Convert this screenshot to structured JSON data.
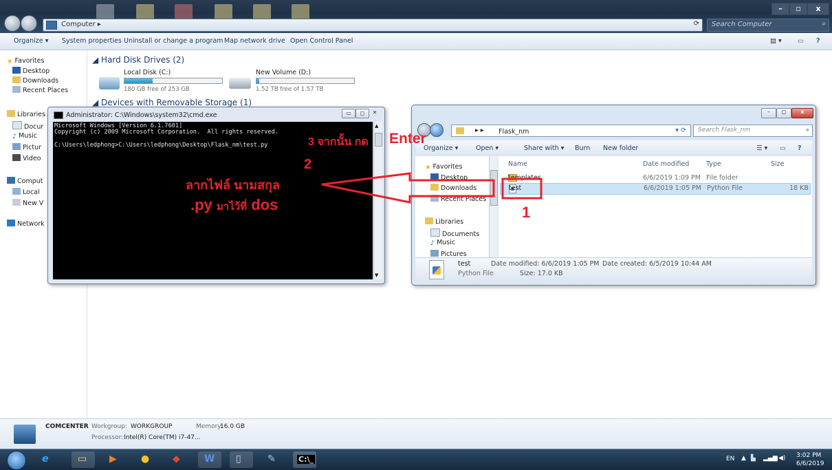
{
  "explorer": {
    "breadcrumb": "Computer",
    "search_placeholder": "Search Computer",
    "command_bar": [
      "Organize ▾",
      "System properties",
      "Uninstall or change a program",
      "Map network drive",
      "Open Control Panel"
    ],
    "nav": {
      "favorites": "Favorites",
      "desktop": "Desktop",
      "downloads": "Downloads",
      "recent": "Recent Places",
      "libraries": "Libraries",
      "documents": "Docur",
      "music": "Music",
      "pictures": "Pictur",
      "videos": "Video",
      "computer": "Comput",
      "local": "Local",
      "newvol": "New V",
      "network": "Network"
    },
    "hard_disks_header": "Hard Disk Drives (2)",
    "drive_c": {
      "name": "Local Disk (C:)",
      "free": "180 GB free of 253 GB",
      "used_fraction": 0.29
    },
    "drive_d": {
      "name": "New Volume (D:)",
      "free": "1.52 TB free of 1.57 TB",
      "used_fraction": 0.03
    },
    "removable_header": "Devices with Removable Storage (1)",
    "details": {
      "name": "COMCENTER",
      "workgroup_label": "Workgroup:",
      "workgroup": "WORKGROUP",
      "memory_label": "Memory:",
      "memory": "16.0 GB",
      "processor_label": "Processor:",
      "processor": "Intel(R) Core(TM) i7-47..."
    }
  },
  "cmd": {
    "title": "Administrator: C:\\Windows\\system32\\cmd.exe",
    "line1": "Microsoft Windows [Version 6.1.7601]",
    "line2": "Copyright (c) 2009 Microsoft Corporation.  All rights reserved.",
    "line3": "C:\\Users\\ledphong>C:\\Users\\ledphong\\Desktop\\Flask_nm\\test.py"
  },
  "flask_window": {
    "breadcrumb": "Flask_nm",
    "search_placeholder": "Search Flask_nm",
    "toolbar": [
      "Organize ▾",
      "Open ▾",
      "Share with ▾",
      "Burn",
      "New folder"
    ],
    "nav": {
      "favorites": "Favorites",
      "desktop": "Desktop",
      "downloads": "Downloads",
      "recent": "Recent Places",
      "libraries": "Libraries",
      "documents": "Documents",
      "music": "Music",
      "pictures": "Pictures"
    },
    "columns": [
      "Name",
      "Date modified",
      "Type",
      "Size"
    ],
    "rows": [
      {
        "name": "templates",
        "date": "6/6/2019 1:09 PM",
        "type": "File folder",
        "size": ""
      },
      {
        "name": "test",
        "date": "6/6/2019 1:05 PM",
        "type": "Python File",
        "size": "18 KB"
      }
    ],
    "details": {
      "name": "test",
      "type": "Python File",
      "modified": "Date modified: 6/6/2019 1:05 PM",
      "size": "Size: 17.0 KB",
      "created": "Date created: 6/5/2019 10:44 AM"
    }
  },
  "annotations": {
    "step1": "1",
    "step2": "2",
    "step3": "3 จากนั้น กด",
    "enter": "Enter",
    "drag_line1": "ลากไฟล์ นามสกุล",
    "drag_line2_ext": ".py",
    "drag_line2_rest": "มาไว้ที่",
    "drag_line2_dos": "dos",
    "color": "#e8232d"
  },
  "taskbar": {
    "lang": "EN",
    "time": "3:02 PM",
    "date": "6/6/2019"
  }
}
